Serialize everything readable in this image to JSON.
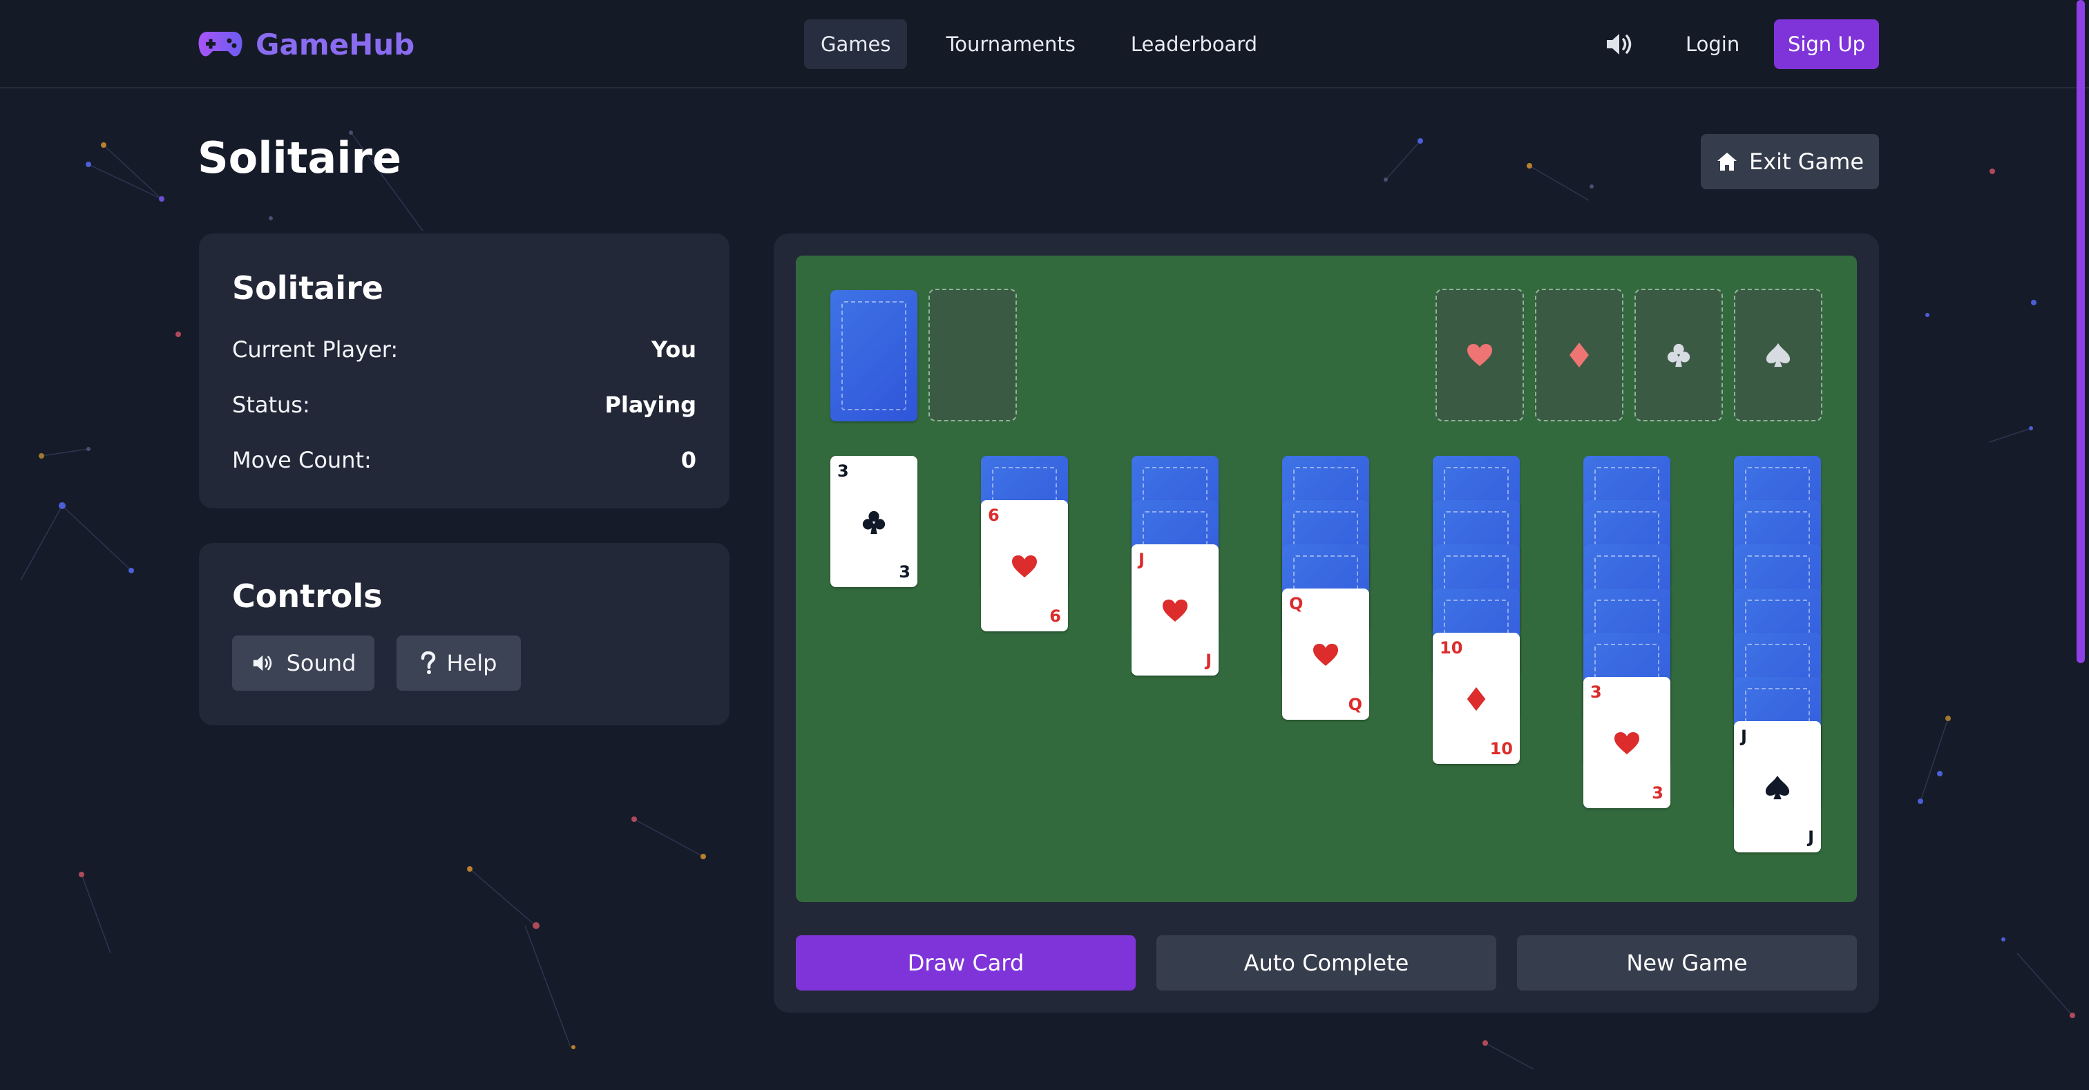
{
  "header": {
    "brand": "GameHub",
    "nav": [
      "Games",
      "Tournaments",
      "Leaderboard"
    ],
    "active_nav": "Games",
    "login": "Login",
    "signup": "Sign Up",
    "sound_icon": "volume-icon"
  },
  "page": {
    "title": "Solitaire",
    "exit_label": "Exit Game"
  },
  "info": {
    "title": "Solitaire",
    "rows": [
      {
        "label": "Current Player:",
        "value": "You"
      },
      {
        "label": "Status:",
        "value": "Playing"
      },
      {
        "label": "Move Count:",
        "value": "0"
      }
    ]
  },
  "controls": {
    "title": "Controls",
    "sound_label": "Sound",
    "help_label": "Help"
  },
  "board": {
    "foundations": [
      "heart",
      "diamond",
      "club",
      "spade"
    ],
    "tableau": [
      {
        "hidden": 0,
        "rank": "3",
        "suit": "club"
      },
      {
        "hidden": 1,
        "rank": "6",
        "suit": "heart"
      },
      {
        "hidden": 2,
        "rank": "J",
        "suit": "heart"
      },
      {
        "hidden": 3,
        "rank": "Q",
        "suit": "heart"
      },
      {
        "hidden": 4,
        "rank": "10",
        "suit": "diamond"
      },
      {
        "hidden": 5,
        "rank": "3",
        "suit": "heart"
      },
      {
        "hidden": 6,
        "rank": "J",
        "suit": "spade"
      }
    ]
  },
  "actions": {
    "draw": "Draw Card",
    "auto": "Auto Complete",
    "new": "New Game"
  },
  "colors": {
    "accent": "#7f34d9",
    "board_green": "#336a3d",
    "card_back": "#3f73e6",
    "panel": "#232838",
    "red_suit": "#dc2c2c"
  }
}
